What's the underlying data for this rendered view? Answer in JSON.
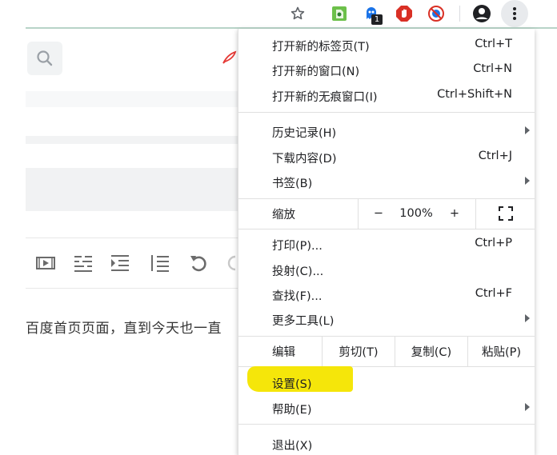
{
  "toolbar": {
    "notification_badge": "1"
  },
  "page": {
    "content_text": "百度首页页面，直到今天也一直"
  },
  "menu": {
    "new_tab": {
      "label": "打开新的标签页(T)",
      "shortcut": "Ctrl+T"
    },
    "new_window": {
      "label": "打开新的窗口(N)",
      "shortcut": "Ctrl+N"
    },
    "new_incognito": {
      "label": "打开新的无痕窗口(I)",
      "shortcut": "Ctrl+Shift+N"
    },
    "history": {
      "label": "历史记录(H)"
    },
    "downloads": {
      "label": "下载内容(D)",
      "shortcut": "Ctrl+J"
    },
    "bookmarks": {
      "label": "书签(B)"
    },
    "zoom": {
      "label": "缩放",
      "minus": "−",
      "value": "100%",
      "plus": "+"
    },
    "print": {
      "label": "打印(P)...",
      "shortcut": "Ctrl+P"
    },
    "cast": {
      "label": "投射(C)..."
    },
    "find": {
      "label": "查找(F)...",
      "shortcut": "Ctrl+F"
    },
    "more_tools": {
      "label": "更多工具(L)"
    },
    "edit": {
      "label": "编辑",
      "cut": "剪切(T)",
      "copy": "复制(C)",
      "paste": "粘贴(P)"
    },
    "settings": {
      "label": "设置(S)"
    },
    "help": {
      "label": "帮助(E)"
    },
    "exit": {
      "label": "退出(X)"
    }
  },
  "colors": {
    "highlight": "#f5e60a",
    "extension_green": "#4caf50",
    "extension_red": "#d93025"
  }
}
